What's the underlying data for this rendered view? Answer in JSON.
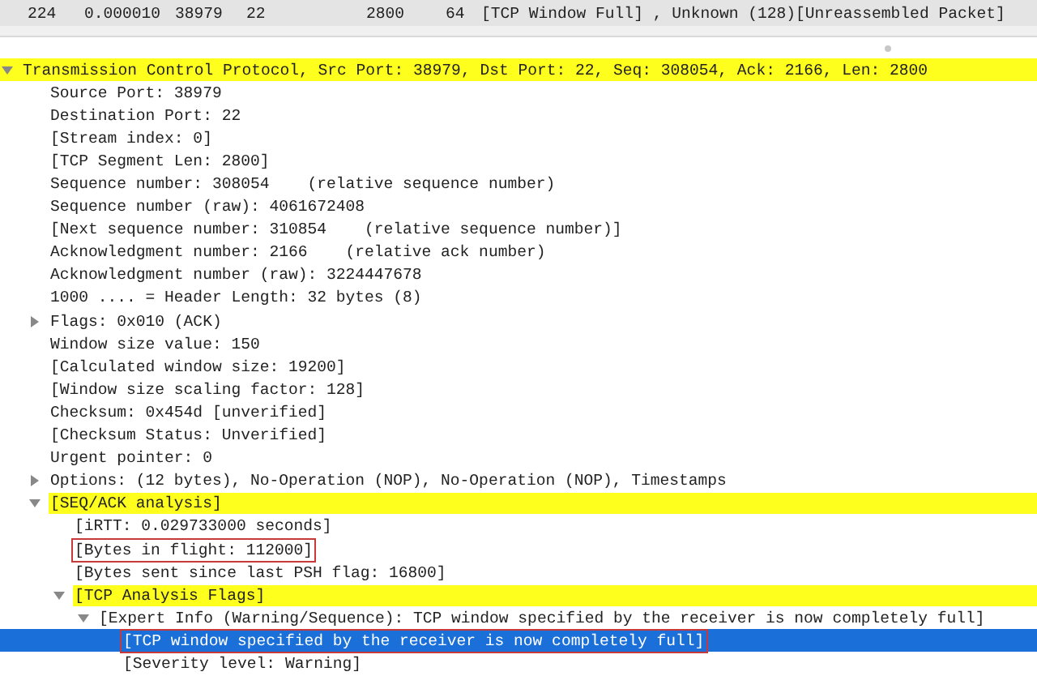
{
  "packet_row": {
    "selected": true,
    "cells": [
      "224",
      "0.000010",
      "38979",
      "22",
      "2800",
      "64",
      "[TCP Window Full] , Unknown (128)[Unreassembled Packet]"
    ]
  },
  "tree": [
    {
      "text": "Transmission Control Protocol, Src Port: 38979, Dst Port: 22, Seq: 308054, Ack: 2166, Len: 2800",
      "expanded": true,
      "highlighted": true,
      "children": [
        {
          "text": "Source Port: 38979"
        },
        {
          "text": "Destination Port: 22"
        },
        {
          "text": "[Stream index: 0]"
        },
        {
          "text": "[TCP Segment Len: 2800]"
        },
        {
          "text": "Sequence number: 308054    (relative sequence number)"
        },
        {
          "text": "Sequence number (raw): 4061672408"
        },
        {
          "text": "[Next sequence number: 310854    (relative sequence number)]"
        },
        {
          "text": "Acknowledgment number: 2166    (relative ack number)"
        },
        {
          "text": "Acknowledgment number (raw): 3224447678"
        },
        {
          "text": "1000 .... = Header Length: 32 bytes (8)"
        },
        {
          "text": "Flags: 0x010 (ACK)",
          "expanded": false
        },
        {
          "text": "Window size value: 150"
        },
        {
          "text": "[Calculated window size: 19200]"
        },
        {
          "text": "[Window size scaling factor: 128]"
        },
        {
          "text": "Checksum: 0x454d [unverified]"
        },
        {
          "text": "[Checksum Status: Unverified]"
        },
        {
          "text": "Urgent pointer: 0"
        },
        {
          "text": "Options: (12 bytes), No-Operation (NOP), No-Operation (NOP), Timestamps",
          "expanded": false
        },
        {
          "text": "[SEQ/ACK analysis]",
          "expanded": true,
          "highlighted": true,
          "children": [
            {
              "text": "[iRTT: 0.029733000 seconds]"
            },
            {
              "text": "[Bytes in flight: 112000]",
              "boxed": true
            },
            {
              "text": "[Bytes sent since last PSH flag: 16800]"
            },
            {
              "text": "[TCP Analysis Flags]",
              "expanded": true,
              "highlighted": true,
              "children": [
                {
                  "text": "[Expert Info (Warning/Sequence): TCP window specified by the receiver is now completely full]",
                  "expanded": true,
                  "children": [
                    {
                      "text": "[TCP window specified by the receiver is now completely full]",
                      "selected": true,
                      "boxed": true
                    },
                    {
                      "text": "[Severity level: Warning]"
                    }
                  ]
                }
              ]
            }
          ]
        }
      ]
    }
  ]
}
